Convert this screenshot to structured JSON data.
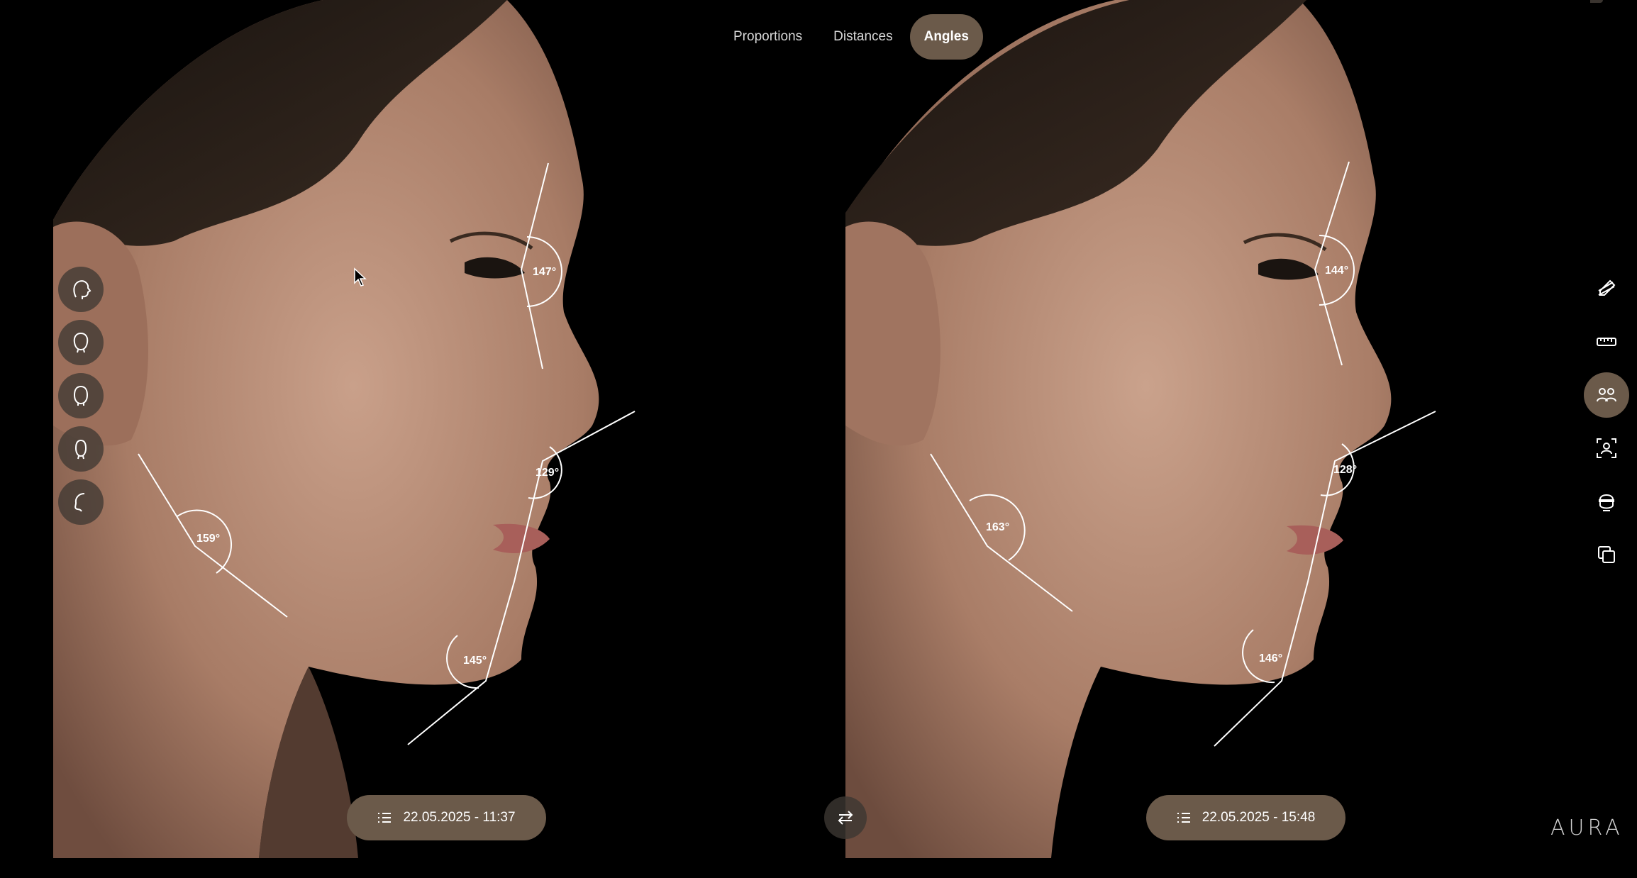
{
  "tabs": [
    {
      "label": "Proportions",
      "active": false
    },
    {
      "label": "Distances",
      "active": false
    },
    {
      "label": "Angles",
      "active": true
    }
  ],
  "left_panel": {
    "angles": {
      "forehead_nose": "147°",
      "nasolabial": "129°",
      "jaw": "159°",
      "chin": "145°"
    },
    "date": "22.05.2025 - 11:37"
  },
  "right_panel": {
    "angles": {
      "forehead_nose": "144°",
      "nasolabial": "128°",
      "jaw": "163°",
      "chin": "146°"
    },
    "date": "22.05.2025 - 15:48"
  },
  "left_tools": [
    "head-profile-icon",
    "head-front-icon",
    "head-oval-icon",
    "head-narrow-icon",
    "head-side-icon"
  ],
  "right_tools": [
    {
      "icon": "pen-measure-icon",
      "active": false
    },
    {
      "icon": "ruler-icon",
      "active": false
    },
    {
      "icon": "compare-users-icon",
      "active": true
    },
    {
      "icon": "face-scan-icon",
      "active": false
    },
    {
      "icon": "face-mask-icon",
      "active": false
    },
    {
      "icon": "duplicate-icon",
      "active": false
    }
  ],
  "logo": "AURA",
  "colors": {
    "accent": "#6b5a4a",
    "background": "#000000",
    "skin": "#b98f78",
    "hair": "#2a211b"
  }
}
